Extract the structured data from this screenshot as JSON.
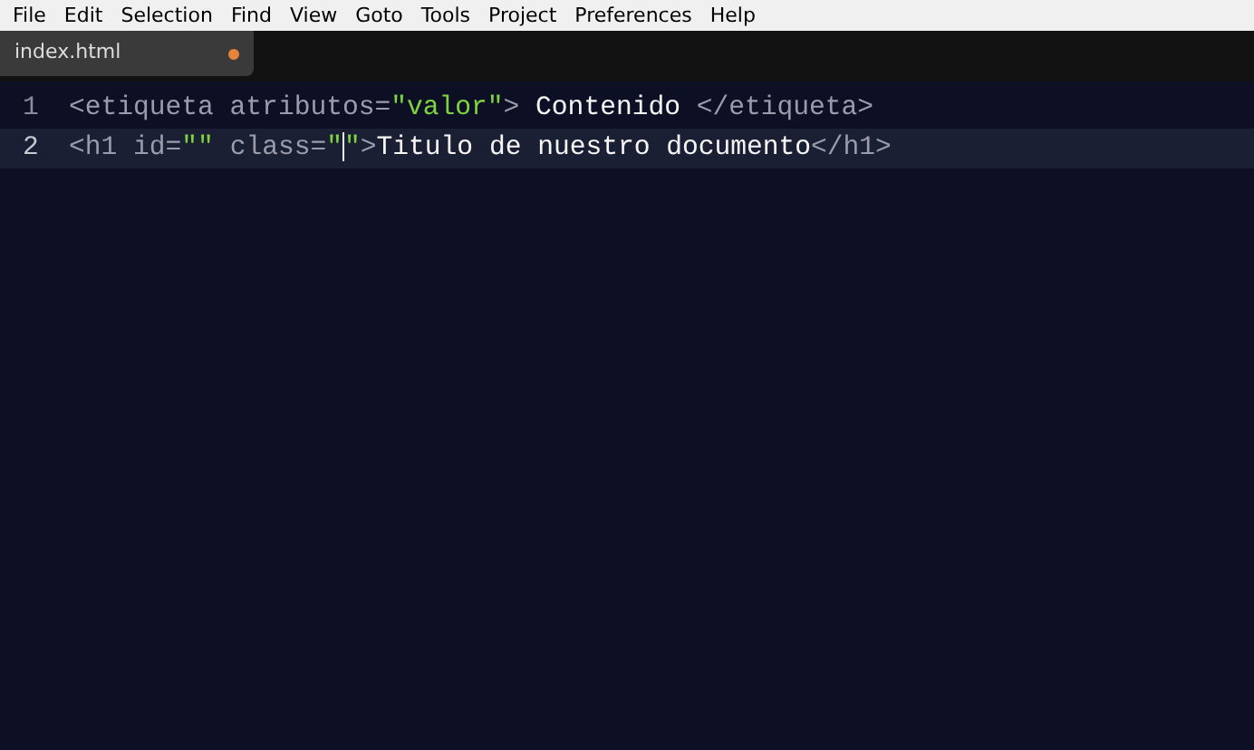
{
  "menu": [
    "File",
    "Edit",
    "Selection",
    "Find",
    "View",
    "Goto",
    "Tools",
    "Project",
    "Preferences",
    "Help"
  ],
  "tabs": [
    {
      "label": "index.html",
      "selected": true,
      "modified": true
    }
  ],
  "editor": {
    "lines": [
      {
        "number": "1",
        "current": false,
        "tokens": [
          {
            "kind": "tag",
            "text": "<etiqueta"
          },
          {
            "kind": "attr",
            "text": " atributos="
          },
          {
            "kind": "string",
            "text": "\"valor\""
          },
          {
            "kind": "tag",
            "text": ">"
          },
          {
            "kind": "text",
            "text": " Contenido "
          },
          {
            "kind": "tag",
            "text": "</etiqueta>"
          }
        ]
      },
      {
        "number": "2",
        "current": true,
        "tokens": [
          {
            "kind": "tag",
            "text": "<h1"
          },
          {
            "kind": "attr",
            "text": " id="
          },
          {
            "kind": "string",
            "text": "\"\""
          },
          {
            "kind": "attr",
            "text": " class="
          },
          {
            "kind": "string",
            "text": "\""
          },
          {
            "kind": "cursor"
          },
          {
            "kind": "string",
            "text": "\""
          },
          {
            "kind": "tag",
            "text": ">"
          },
          {
            "kind": "text",
            "text": "Titulo de nuestro documento"
          },
          {
            "kind": "tag",
            "text": "</h1>"
          }
        ]
      }
    ]
  }
}
